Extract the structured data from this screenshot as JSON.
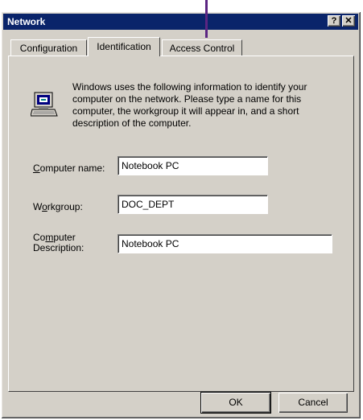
{
  "window": {
    "title": "Network",
    "help_glyph": "?",
    "close_glyph": "✕"
  },
  "tabs": [
    {
      "label": "Configuration"
    },
    {
      "label": "Identification"
    },
    {
      "label": "Access Control"
    }
  ],
  "description": "Windows uses the following information to identify your computer on the network.  Please type a name for this computer, the workgroup it will appear in, and a short description of the computer.",
  "fields": {
    "computer_name": {
      "label_pre": "",
      "label_accel": "C",
      "label_post": "omputer name:",
      "value": "Notebook PC"
    },
    "workgroup": {
      "label_pre": "W",
      "label_accel": "o",
      "label_post": "rkgroup:",
      "value": "DOC_DEPT"
    },
    "description": {
      "label_line1_pre": "Co",
      "label_line1_accel": "m",
      "label_line1_post": "puter",
      "label_line2": "Description:",
      "value": "Notebook PC"
    }
  },
  "buttons": {
    "ok": "OK",
    "cancel": "Cancel"
  },
  "icons": {
    "computer": "network-computer-icon"
  },
  "colors": {
    "titlebar": "#0a246a",
    "face": "#d4d0c8",
    "pointer": "#5b2582"
  }
}
